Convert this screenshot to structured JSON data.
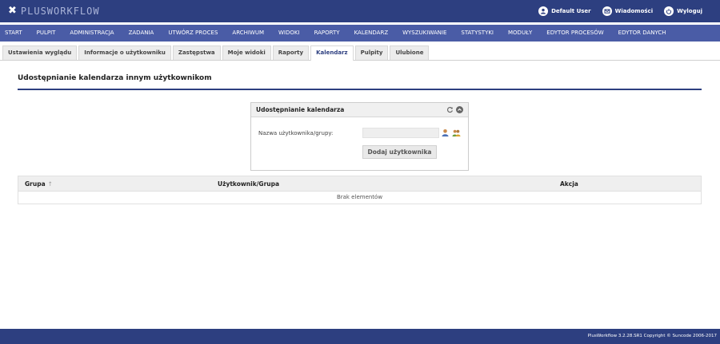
{
  "brand": {
    "logo_mark": "✖",
    "logo_text": "PLUSWORKFLOW"
  },
  "header": {
    "user_label": "Default User",
    "messages_label": "Wiadomości",
    "logout_label": "Wyloguj",
    "icons": [
      "user-icon",
      "envelope-icon",
      "power-icon"
    ]
  },
  "nav": {
    "items": [
      "START",
      "PULPIT",
      "ADMINISTRACJA",
      "ZADANIA",
      "UTWÓRZ PROCES",
      "ARCHIWUM",
      "WIDOKI",
      "RAPORTY",
      "KALENDARZ",
      "WYSZUKIWANIE",
      "STATYSTYKI",
      "MODUŁY",
      "EDYTOR PROCESÓW",
      "EDYTOR DANYCH"
    ]
  },
  "tabs": {
    "items": [
      "Ustawienia wyglądu",
      "Informacje o użytkowniku",
      "Zastępstwa",
      "Moje widoki",
      "Raporty",
      "Kalendarz",
      "Pulpity",
      "Ulubione"
    ],
    "active_index": 5
  },
  "section": {
    "title": "Udostępnianie kalendarza innym użytkownikom"
  },
  "panel": {
    "title": "Udostępnianie kalendarza",
    "field_label": "Nazwa użytkownika/grupy:",
    "field_value": "",
    "add_button": "Dodaj użytkownika",
    "icons": [
      "refresh-icon",
      "collapse-icon",
      "user-search-icon",
      "group-search-icon"
    ]
  },
  "table": {
    "columns": [
      "Grupa",
      "Użytkownik/Grupa",
      "Akcja"
    ],
    "sort_glyph": "↑",
    "empty_text": "Brak elementów"
  },
  "footer": {
    "text": "PlusWorkflow 3.2.28.SR1 Copyright © Suncode 2006-2017"
  },
  "colors": {
    "header": "#2d3f80",
    "nav": "#4a5ca6",
    "accent": "#2d3f80"
  }
}
